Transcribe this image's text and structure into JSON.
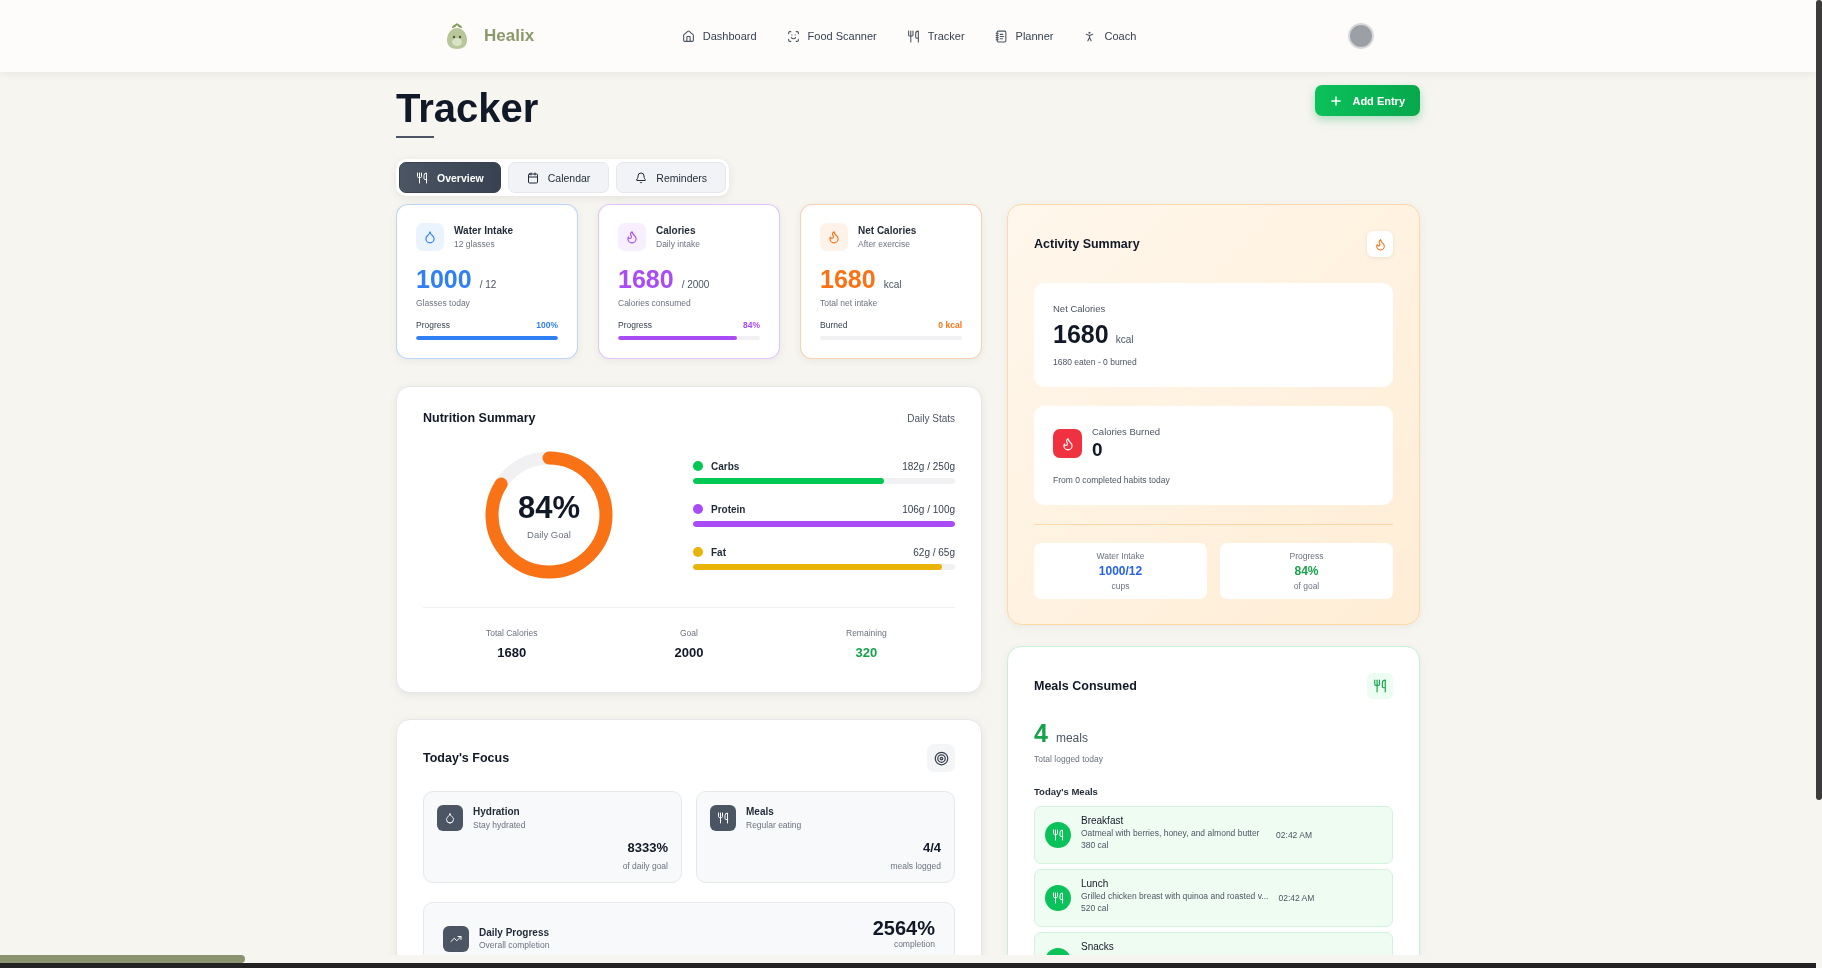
{
  "brand": {
    "name": "Healix"
  },
  "nav": [
    {
      "label": "Dashboard"
    },
    {
      "label": "Food Scanner"
    },
    {
      "label": "Tracker"
    },
    {
      "label": "Planner"
    },
    {
      "label": "Coach"
    }
  ],
  "page": {
    "title": "Tracker",
    "add_button": "Add Entry"
  },
  "tabs": [
    {
      "label": "Overview",
      "selected": true
    },
    {
      "label": "Calendar",
      "selected": false
    },
    {
      "label": "Reminders",
      "selected": false
    }
  ],
  "stat_cards": [
    {
      "title": "Water Intake",
      "subtitle": "12 glasses",
      "value": "1000",
      "unit": "/ 12",
      "caption": "Glasses today",
      "bar_label": "Progress",
      "bar_reading": "100%",
      "level": 1,
      "color": "#2f7ff5"
    },
    {
      "title": "Calories",
      "subtitle": "Daily intake",
      "value": "1680",
      "unit": "/ 2000",
      "caption": "Calories consumed",
      "bar_label": "Progress",
      "bar_reading": "84%",
      "level": 0.84,
      "color": "#a94cf5"
    },
    {
      "title": "Net Calories",
      "subtitle": "After exercise",
      "value": "1680",
      "unit": "kcal",
      "caption": "Total net intake",
      "bar_label": "Burned",
      "bar_reading": "0 kcal",
      "level": 0,
      "color": "#f97316"
    }
  ],
  "nutrition": {
    "title": "Nutrition Summary",
    "aside": "Daily Stats",
    "ring": {
      "value": "84%",
      "label": "Daily Goal",
      "level": 0.84
    },
    "macros": [
      {
        "name": "Carbs",
        "reading": "182g / 250g",
        "level": 0.73,
        "color": "#00c853"
      },
      {
        "name": "Protein",
        "reading": "106g / 100g",
        "level": 1,
        "color": "#a94cf5"
      },
      {
        "name": "Fat",
        "reading": "62g / 65g",
        "level": 0.95,
        "color": "#eab308"
      }
    ],
    "totals": [
      {
        "label": "Total Calories",
        "value": "1680",
        "kind": "plain"
      },
      {
        "label": "Goal",
        "value": "2000",
        "kind": "plain"
      },
      {
        "label": "Remaining",
        "value": "320",
        "kind": "positive"
      }
    ]
  },
  "focus": {
    "title": "Today's Focus",
    "items": [
      {
        "title": "Hydration",
        "subtitle": "Stay hydrated",
        "value": "8333%",
        "caption": "of daily goal"
      },
      {
        "title": "Meals",
        "subtitle": "Regular eating",
        "value": "4/4",
        "caption": "meals logged"
      }
    ],
    "progress": {
      "title": "Daily Progress",
      "subtitle": "Overall completion",
      "value": "2564%",
      "caption": "completion"
    }
  },
  "activity": {
    "title": "Activity Summary",
    "net": {
      "label": "Net Calories",
      "value": "1680",
      "unit": "kcal",
      "note": "1680 eaten - 0 burned"
    },
    "burned": {
      "label": "Calories Burned",
      "value": "0",
      "note": "From 0 completed habits today"
    },
    "tiles": [
      {
        "label": "Water Intake",
        "value": "1000/12",
        "caption": "cups",
        "color": "#2563eb"
      },
      {
        "label": "Progress",
        "value": "84%",
        "caption": "of goal",
        "color": "#16a34a"
      }
    ]
  },
  "meals": {
    "title": "Meals Consumed",
    "count": "4",
    "unit": "meals",
    "caption": "Total logged today",
    "list_title": "Today's Meals",
    "items": [
      {
        "name": "Breakfast",
        "description": "Oatmeal with berries, honey, and almond butter",
        "calories": "380 cal",
        "time": "02:42 AM"
      },
      {
        "name": "Lunch",
        "description": "Grilled chicken breast with quinoa and roasted v...",
        "calories": "520 cal",
        "time": "02:42 AM"
      },
      {
        "name": "Snacks"
      }
    ]
  }
}
